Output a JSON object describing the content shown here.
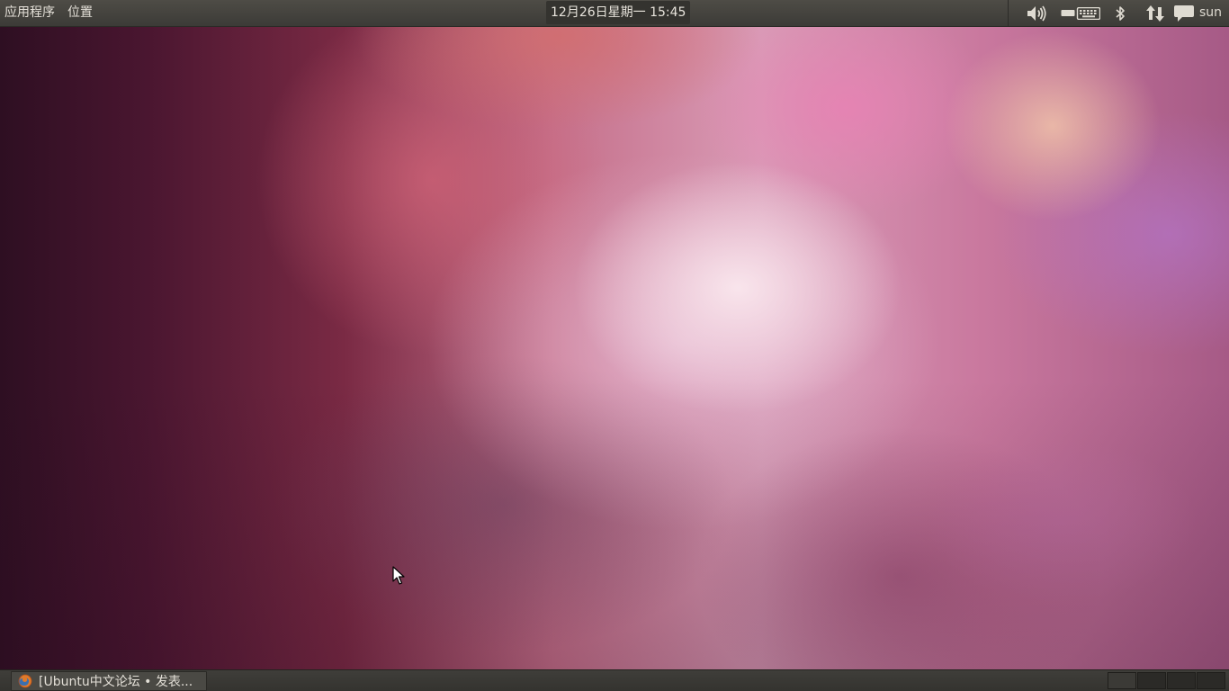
{
  "top_panel": {
    "menus": {
      "applications": "应用程序",
      "places": "位置"
    },
    "clock": "12月26日星期一 15:45",
    "indicators": {
      "volume_icon": "speaker-icon",
      "keyboard_icon": "keyboard-icon",
      "bluetooth_icon": "bluetooth-icon",
      "network_icon": "network-arrows-icon",
      "messages_icon": "speech-bubble-icon"
    },
    "user": "sun"
  },
  "bottom_panel": {
    "tasks": [
      {
        "label": "[Ubuntu中文论坛 • 发表...",
        "icon": "firefox-icon"
      }
    ],
    "workspaces": 4
  },
  "colors": {
    "panel_bg": "#3c3b37",
    "panel_text": "#dfdbd2",
    "wallpaper_accent": "#c5708a"
  }
}
